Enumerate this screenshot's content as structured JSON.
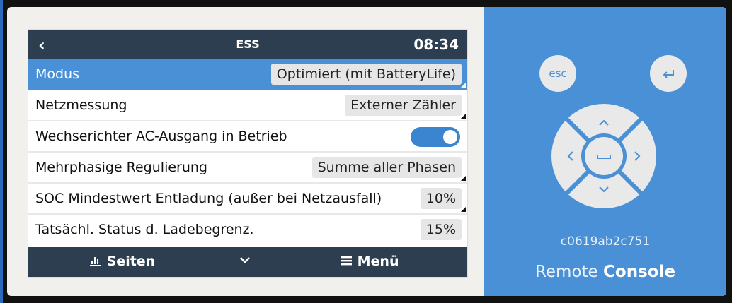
{
  "header": {
    "back_icon": "‹",
    "title": "ESS",
    "time": "08:34"
  },
  "settings": [
    {
      "label": "Modus",
      "value": "Optimiert (mit BatteryLife)"
    },
    {
      "label": "Netzmessung",
      "value": "Externer Zähler"
    },
    {
      "label": "Wechserichter AC-Ausgang in Betrieb",
      "toggle_on": true
    },
    {
      "label": "Mehrphasige Regulierung",
      "value": "Summe aller Phasen"
    },
    {
      "label": "SOC Mindestwert Entladung (außer bei Netzausfall)",
      "value": "10%"
    },
    {
      "label": "Tatsächl. Status d. Ladebegrenz.",
      "value": "15%"
    }
  ],
  "footer": {
    "pages_label": "Seiten",
    "menu_label": "Menü"
  },
  "remote": {
    "esc_label": "esc",
    "enter_icon": "enter-icon",
    "hostname": "c0619ab2c751",
    "brand_light": "Remote ",
    "brand_bold": "Console"
  },
  "colors": {
    "accent": "#4a90d6",
    "bar": "#2c3e50"
  }
}
